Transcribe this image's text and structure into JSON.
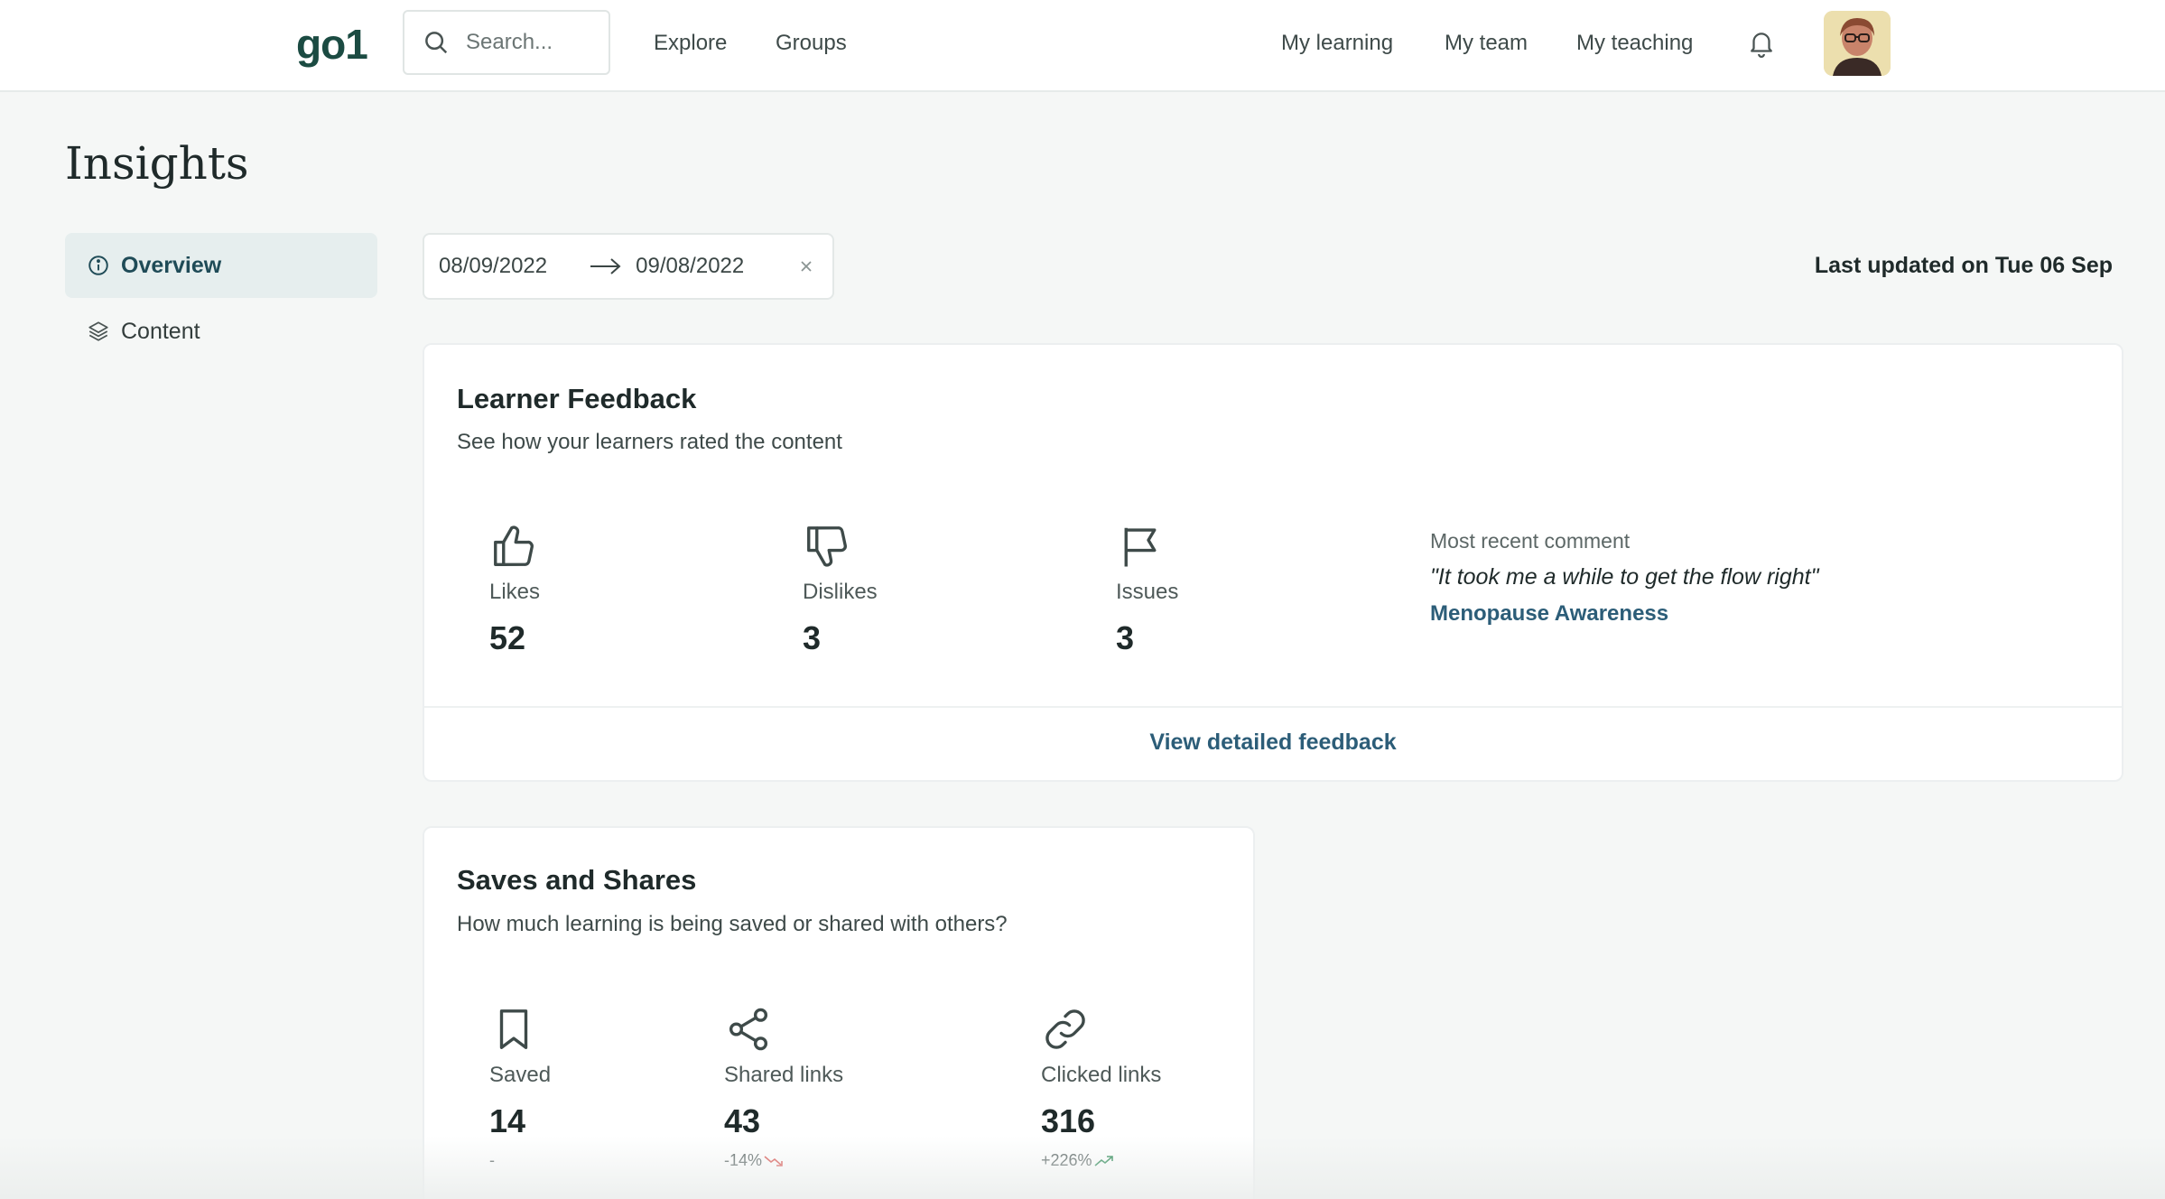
{
  "header": {
    "logo": "go1",
    "search_placeholder": "Search...",
    "nav_left": [
      "Explore",
      "Groups"
    ],
    "nav_right": [
      "My learning",
      "My team",
      "My teaching"
    ]
  },
  "page": {
    "title": "Insights"
  },
  "sidebar": {
    "items": [
      {
        "label": "Overview",
        "icon": "info-circle-icon",
        "active": true
      },
      {
        "label": "Content",
        "icon": "layers-icon",
        "active": false
      }
    ]
  },
  "filters": {
    "date_from": "08/09/2022",
    "date_to": "09/08/2022",
    "last_updated": "Last updated on Tue 06 Sep"
  },
  "feedback": {
    "title": "Learner Feedback",
    "subtitle": "See how your learners rated the content",
    "metrics": [
      {
        "label": "Likes",
        "value": "52",
        "icon": "thumbs-up-icon"
      },
      {
        "label": "Dislikes",
        "value": "3",
        "icon": "thumbs-down-icon"
      },
      {
        "label": "Issues",
        "value": "3",
        "icon": "flag-icon"
      }
    ],
    "comment": {
      "label": "Most recent comment",
      "quote": "\"It took me a while to get the flow right\"",
      "course": "Menopause Awareness"
    },
    "view_link": "View detailed feedback"
  },
  "saves": {
    "title": "Saves and Shares",
    "subtitle": "How much learning is being saved or shared with others?",
    "metrics": [
      {
        "label": "Saved",
        "value": "14",
        "delta": "-",
        "icon": "bookmark-icon"
      },
      {
        "label": "Shared links",
        "value": "43",
        "delta": "-14%",
        "icon": "share-icon",
        "trend": "down"
      },
      {
        "label": "Clicked links",
        "value": "316",
        "delta": "+226%",
        "icon": "link-icon",
        "trend": "up"
      }
    ]
  },
  "colors": {
    "accent": "#2c5d78",
    "logo": "#1b4b42",
    "active_bg": "#e6eeee",
    "trend_down": "#d9534f",
    "trend_up": "#2e8b57"
  }
}
